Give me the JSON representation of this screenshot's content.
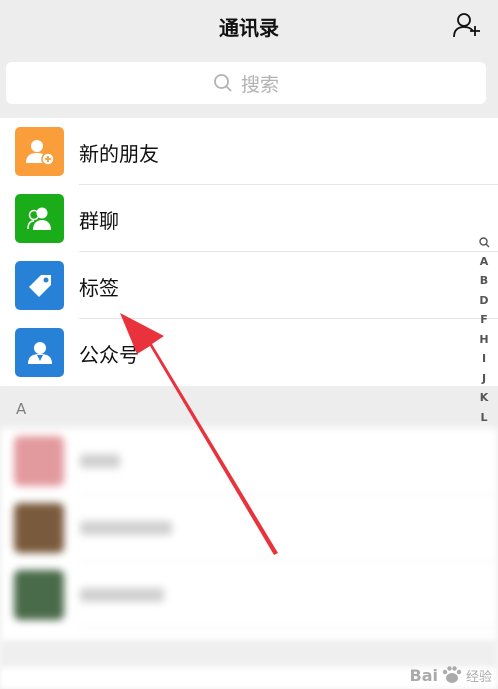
{
  "header": {
    "title": "通讯录",
    "add_icon": "add-contact-icon"
  },
  "search": {
    "placeholder": "搜索",
    "icon": "search-icon"
  },
  "menu": [
    {
      "label": "新的朋友",
      "icon": "new-friend-icon",
      "color": "#fa9d3b"
    },
    {
      "label": "群聊",
      "icon": "group-chat-icon",
      "color": "#1aad19"
    },
    {
      "label": "标签",
      "icon": "tag-icon",
      "color": "#2782d7"
    },
    {
      "label": "公众号",
      "icon": "official-account-icon",
      "color": "#2782d7"
    }
  ],
  "section": {
    "letter": "A"
  },
  "index_bar": [
    "Q",
    "A",
    "B",
    "D",
    "F",
    "H",
    "I",
    "J",
    "K",
    "L"
  ],
  "annotation": {
    "arrow_color": "#e8333c"
  },
  "watermark": {
    "text": "Bai",
    "sub": "经验"
  }
}
